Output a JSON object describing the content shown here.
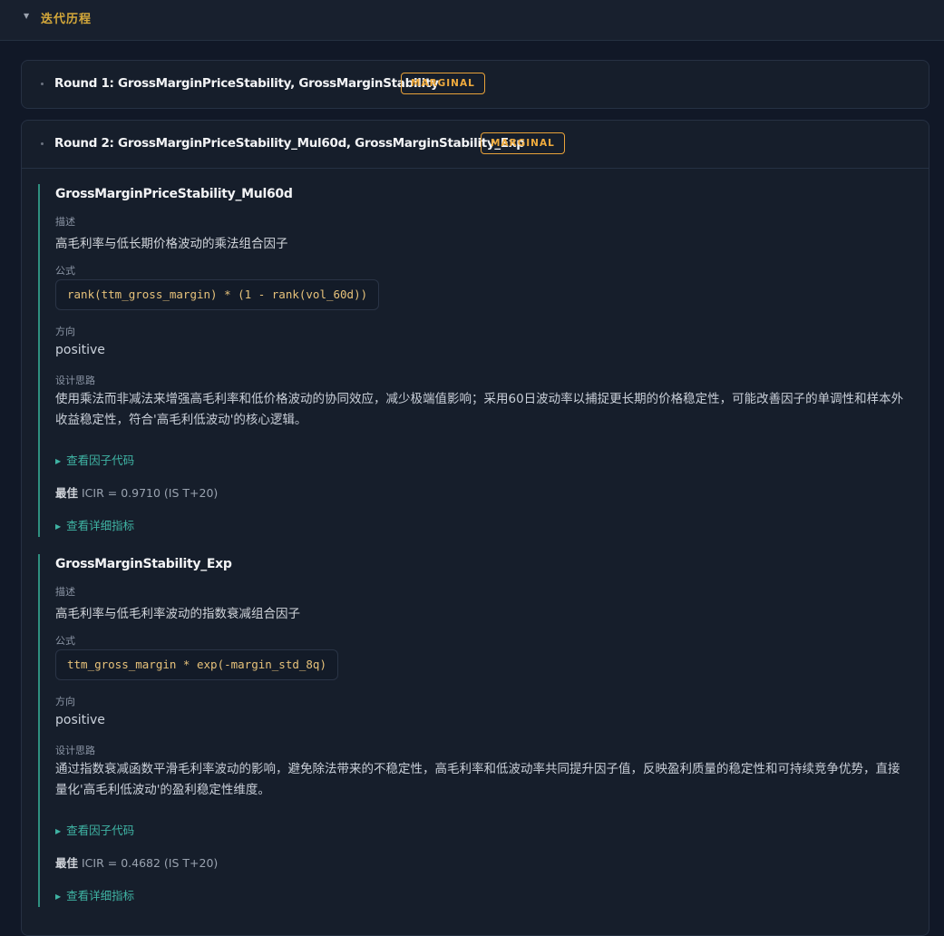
{
  "section": {
    "title": "迭代历程"
  },
  "rounds": [
    {
      "title": "Round 1: GrossMarginPriceStability, GrossMarginStability",
      "badge": "MARGINAL"
    },
    {
      "title": "Round 2: GrossMarginPriceStability_Mul60d, GrossMarginStability_Exp",
      "badge": "MARGINAL",
      "factors": [
        {
          "name": "GrossMarginPriceStability_Mul60d",
          "desc_label": "描述",
          "desc": "高毛利率与低长期价格波动的乘法组合因子",
          "formula_label": "公式",
          "formula": "rank(ttm_gross_margin) * (1 - rank(vol_60d))",
          "direction_label": "方向",
          "direction": "positive",
          "rationale_label": "设计思路",
          "rationale": "使用乘法而非减法来增强高毛利率和低价格波动的协同效应，减少极端值影响；采用60日波动率以捕捉更长期的价格稳定性，可能改善因子的单调性和样本外收益稳定性，符合'高毛利低波动'的核心逻辑。",
          "code_toggle": "查看因子代码",
          "best_prefix": "最佳",
          "best_value": "ICIR = 0.9710 (IS T+20)",
          "metrics_toggle": "查看详细指标"
        },
        {
          "name": "GrossMarginStability_Exp",
          "desc_label": "描述",
          "desc": "高毛利率与低毛利率波动的指数衰减组合因子",
          "formula_label": "公式",
          "formula": "ttm_gross_margin * exp(-margin_std_8q)",
          "direction_label": "方向",
          "direction": "positive",
          "rationale_label": "设计思路",
          "rationale": "通过指数衰减函数平滑毛利率波动的影响，避免除法带来的不稳定性，高毛利率和低波动率共同提升因子值，反映盈利质量的稳定性和可持续竞争优势，直接量化'高毛利低波动'的盈利稳定性维度。",
          "code_toggle": "查看因子代码",
          "best_prefix": "最佳",
          "best_value": "ICIR = 0.4682 (IS T+20)",
          "metrics_toggle": "查看详细指标"
        }
      ]
    }
  ]
}
